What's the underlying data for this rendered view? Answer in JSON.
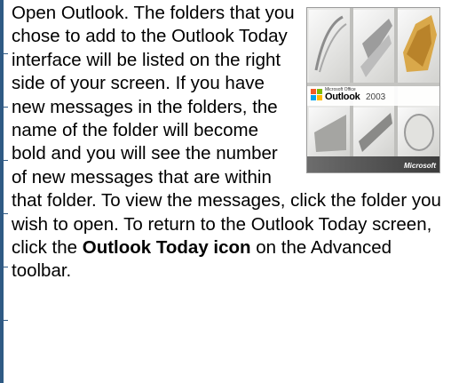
{
  "paragraph": {
    "part1": "Open Outlook.  The folders that you chose to add to the Outlook Today interface will be listed on the right side of your screen.  If you have new messages in the folders, the name of the folder will become bold and you will see the number of new messages that are within that folder.  To view the messages, click the folder you wish to open.  To return to the Outlook Today screen,  click the ",
    "bold": "Outlook Today icon",
    "part2": " on the Advanced toolbar."
  },
  "cover": {
    "office_small": "Microsoft Office",
    "product_name": "Outlook",
    "product_year": "2003",
    "brand": "Microsoft"
  },
  "colors": {
    "accent": "#2f5a84"
  }
}
